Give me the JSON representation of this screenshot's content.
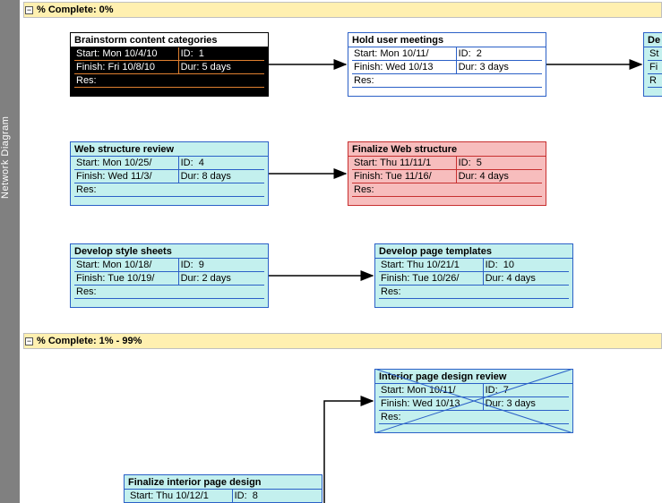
{
  "sidebar_label": "Network Diagram",
  "groups": [
    {
      "label": "% Complete: 0%"
    },
    {
      "label": "% Complete: 1% - 99%"
    }
  ],
  "nodes": {
    "n1": {
      "title": "Brainstorm content categories",
      "start_label": "Start:",
      "start": "Mon 10/4/10",
      "id_label": "ID:",
      "id": "1",
      "finish_label": "Finish:",
      "finish": "Fri 10/8/10",
      "dur_label": "Dur:",
      "dur": "5 days",
      "res_label": "Res:",
      "res": ""
    },
    "n2": {
      "title": "Hold user meetings",
      "start_label": "Start:",
      "start": "Mon 10/11/",
      "id_label": "ID:",
      "id": "2",
      "finish_label": "Finish:",
      "finish": "Wed 10/13",
      "dur_label": "Dur:",
      "dur": "3 days",
      "res_label": "Res:",
      "res": ""
    },
    "n3": {
      "title": "De",
      "start_label": "St",
      "start": "",
      "id_label": "",
      "id": "",
      "finish_label": "Fi",
      "finish": "",
      "dur_label": "",
      "dur": "",
      "res_label": "R",
      "res": ""
    },
    "n4": {
      "title": "Web structure review",
      "start_label": "Start:",
      "start": "Mon 10/25/",
      "id_label": "ID:",
      "id": "4",
      "finish_label": "Finish:",
      "finish": "Wed 11/3/",
      "dur_label": "Dur:",
      "dur": "8 days",
      "res_label": "Res:",
      "res": ""
    },
    "n5": {
      "title": "Finalize Web structure",
      "start_label": "Start:",
      "start": "Thu 11/11/1",
      "id_label": "ID:",
      "id": "5",
      "finish_label": "Finish:",
      "finish": "Tue 11/16/",
      "dur_label": "Dur:",
      "dur": "4 days",
      "res_label": "Res:",
      "res": ""
    },
    "n9": {
      "title": "Develop style sheets",
      "start_label": "Start:",
      "start": "Mon 10/18/",
      "id_label": "ID:",
      "id": "9",
      "finish_label": "Finish:",
      "finish": "Tue 10/19/",
      "dur_label": "Dur:",
      "dur": "2 days",
      "res_label": "Res:",
      "res": ""
    },
    "n10": {
      "title": "Develop page templates",
      "start_label": "Start:",
      "start": "Thu 10/21/1",
      "id_label": "ID:",
      "id": "10",
      "finish_label": "Finish:",
      "finish": "Tue 10/26/",
      "dur_label": "Dur:",
      "dur": "4 days",
      "res_label": "Res:",
      "res": ""
    },
    "n7": {
      "title": "Interior page design review",
      "start_label": "Start:",
      "start": "Mon 10/11/",
      "id_label": "ID:",
      "id": "7",
      "finish_label": "Finish:",
      "finish": "Wed 10/13",
      "dur_label": "Dur:",
      "dur": "3 days",
      "res_label": "Res:",
      "res": ""
    },
    "n8": {
      "title": "Finalize interior page design",
      "start_label": "Start:",
      "start": "Thu 10/12/1",
      "id_label": "ID:",
      "id": "8",
      "finish_label": "Finish:",
      "finish": "",
      "dur_label": "",
      "dur": "",
      "res_label": "",
      "res": ""
    }
  }
}
